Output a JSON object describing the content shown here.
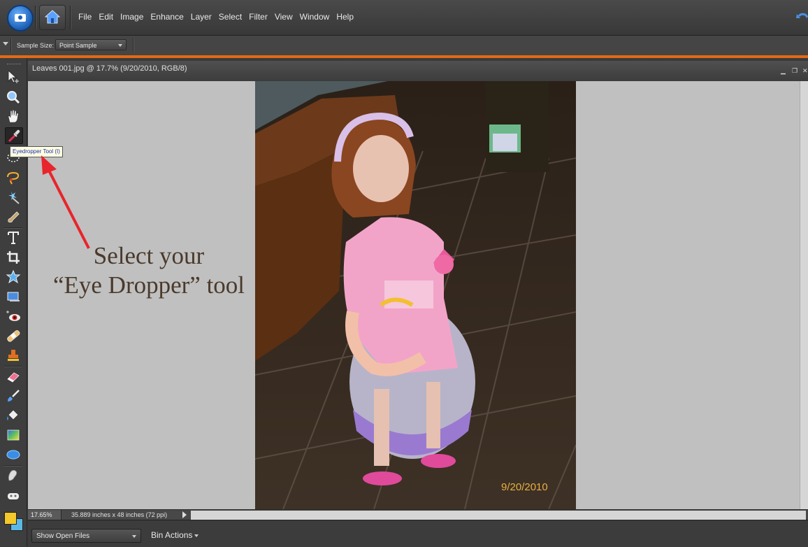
{
  "menubar": {
    "items": [
      "File",
      "Edit",
      "Image",
      "Enhance",
      "Layer",
      "Select",
      "Filter",
      "View",
      "Window",
      "Help"
    ]
  },
  "options": {
    "sample_size_label": "Sample Size:",
    "sample_size_value": "Point Sample"
  },
  "tools": [
    {
      "name": "move-tool"
    },
    {
      "name": "zoom-tool"
    },
    {
      "name": "hand-tool"
    },
    {
      "name": "eyedropper-tool"
    },
    {
      "name": "marquee-tool"
    },
    {
      "name": "lasso-tool"
    },
    {
      "name": "magic-wand-tool"
    },
    {
      "name": "quick-selection-tool"
    },
    {
      "name": "type-tool"
    },
    {
      "name": "crop-tool"
    },
    {
      "name": "cookie-cutter-tool"
    },
    {
      "name": "straighten-tool"
    },
    {
      "name": "red-eye-tool"
    },
    {
      "name": "spot-healing-tool"
    },
    {
      "name": "clone-stamp-tool"
    },
    {
      "name": "eraser-tool"
    },
    {
      "name": "brush-tool"
    },
    {
      "name": "paint-bucket-tool"
    },
    {
      "name": "gradient-tool"
    },
    {
      "name": "shape-tool"
    },
    {
      "name": "blur-tool"
    },
    {
      "name": "sponge-tool"
    }
  ],
  "colors": {
    "foreground": "#f2c82a",
    "background": "#5bb8e6",
    "accent": "#e36a14"
  },
  "tooltip": "Eyedropper Tool (I)",
  "document": {
    "title": "Leaves 001.jpg @ 17.7% (9/20/2010, RGB/8)",
    "zoom": "17.65%",
    "size": "35.889 inches x 48 inches (72 ppi)",
    "date_stamp": "9/20/2010"
  },
  "annotation": {
    "line1": "Select your",
    "line2": "“Eye Dropper” tool"
  },
  "bin": {
    "select_value": "Show Open Files",
    "actions_label": "Bin Actions"
  }
}
